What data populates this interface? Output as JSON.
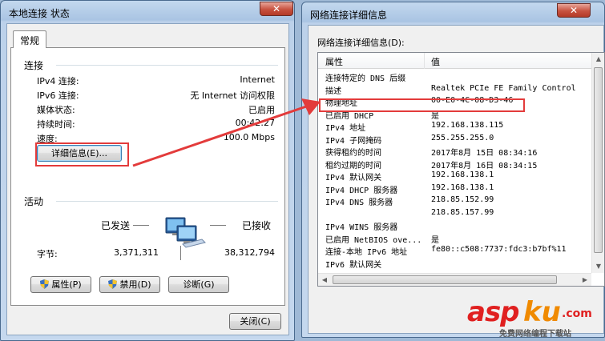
{
  "status_window": {
    "title": "本地连接 状态",
    "close_label": "✕",
    "tab_label": "常规",
    "connection_section": "连接",
    "rows": [
      {
        "label": "IPv4 连接:",
        "value": "Internet"
      },
      {
        "label": "IPv6 连接:",
        "value": "无 Internet 访问权限"
      },
      {
        "label": "媒体状态:",
        "value": "已启用"
      },
      {
        "label": "持续时间:",
        "value": "00:42:27"
      },
      {
        "label": "速度:",
        "value": "100.0 Mbps"
      }
    ],
    "details_button": "详细信息(E)...",
    "activity_section": "活动",
    "sent_label": "已发送",
    "received_label": "已接收",
    "bytes_label": "字节:",
    "bytes_sent": "3,371,311",
    "bytes_received": "38,312,794",
    "properties_button": "属性(P)",
    "disable_button": "禁用(D)",
    "diagnose_button": "诊断(G)",
    "close_button": "关闭(C)"
  },
  "details_window": {
    "title": "网络连接详细信息",
    "close_label": "✕",
    "list_label": "网络连接详细信息(D):",
    "col_property": "属性",
    "col_value": "值",
    "rows": [
      {
        "property": "连接特定的 DNS 后缀",
        "value": ""
      },
      {
        "property": "描述",
        "value": "Realtek PCIe FE Family Control"
      },
      {
        "property": "物理地址",
        "value": "00-E0-4C-08-D3-46"
      },
      {
        "property": "已启用 DHCP",
        "value": "是"
      },
      {
        "property": "IPv4 地址",
        "value": "192.168.138.115"
      },
      {
        "property": "IPv4 子网掩码",
        "value": "255.255.255.0"
      },
      {
        "property": "获得租约的时间",
        "value": "2017年8月 15日 08:34:16"
      },
      {
        "property": "租约过期的时间",
        "value": "2017年8月 16日 08:34:15"
      },
      {
        "property": "IPv4 默认网关",
        "value": "192.168.138.1"
      },
      {
        "property": "IPv4 DHCP 服务器",
        "value": "192.168.138.1"
      },
      {
        "property": "IPv4 DNS 服务器",
        "value": "218.85.152.99"
      },
      {
        "property": "",
        "value": "218.85.157.99"
      },
      {
        "property": "IPv4 WINS 服务器",
        "value": ""
      },
      {
        "property": "已启用 NetBIOS ove...",
        "value": "是"
      },
      {
        "property": "连接-本地 IPv6 地址",
        "value": "fe80::c508:7737:fdc3:b7bf%11"
      },
      {
        "property": "IPv6 默认网关",
        "value": ""
      }
    ]
  },
  "watermark": {
    "brand_a": "asp",
    "brand_b": "ku",
    "brand_c": ".com",
    "tagline": "免费网络编程下载站"
  },
  "colors": {
    "annotation_red": "#e33b3b",
    "brand_red": "#e02020",
    "brand_orange": "#f08a00"
  },
  "icons": {
    "network": "network-computers-icon",
    "shield": "uac-shield-icon"
  }
}
